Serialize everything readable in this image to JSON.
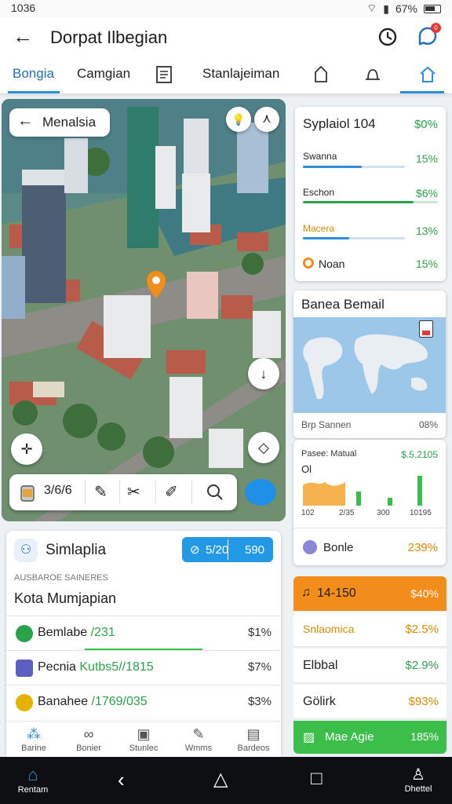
{
  "status": {
    "time": "1036",
    "battery": "67%"
  },
  "appbar": {
    "title": "Dorpat Ilbegian"
  },
  "tabs": [
    {
      "label": "Bongia",
      "active": true
    },
    {
      "label": "Camgian",
      "active": false
    },
    {
      "label": "Stanlajeiman",
      "active": false
    }
  ],
  "map": {
    "search_label": "Menalsia",
    "toolbar_label": "3/6/6"
  },
  "card_stats": {
    "title": "Syplaiol 104",
    "title_pct": "$0%",
    "rows": [
      {
        "label": "Swanna",
        "pct": "15%",
        "fill": 0.58,
        "color": "#2d8fdc"
      },
      {
        "label": "Eschon",
        "pct": "$6%",
        "fill": 0.82,
        "color": "#2aa34a"
      },
      {
        "label": "Macera",
        "pct": "13%",
        "fill": 0.45,
        "color": "#2d8fdc"
      },
      {
        "label": "Noan",
        "pct": "15%",
        "fill": 0,
        "color": "#f28c1a"
      }
    ]
  },
  "card_map": {
    "title": "Banea Bemail",
    "footer_label": "Brp Sannen",
    "footer_pct": "08%"
  },
  "card_chart": {
    "left_label": "Pasee: Matual",
    "left_sub": "Ol",
    "right_value": "$.5.2105",
    "x_ticks": [
      "102",
      "2/35",
      "300",
      "10195"
    ],
    "bars": [
      0.55,
      0.35,
      0.2,
      0.75
    ],
    "bottom_label": "Bonle",
    "bottom_pct": "239%"
  },
  "bottom_panel": {
    "title": "Simlaplia",
    "pill_a": "5/20",
    "pill_b": "590",
    "caption": "AUSBAROE SAINERES",
    "heading": "Kota Mumjapian",
    "rows": [
      {
        "name": "Bemlabe",
        "code": "/231",
        "val": "$1%",
        "icon_color": "#2aa34a"
      },
      {
        "name": "Pecnia",
        "code": "Kutbs5//1815",
        "val": "$7%",
        "icon_color": "#5c5fc0"
      },
      {
        "name": "Banahee",
        "code": "/1769/035",
        "val": "$3%",
        "icon_color": "#e6b200"
      }
    ]
  },
  "mini_nav": [
    {
      "label": "Barine",
      "icon": "dots-icon"
    },
    {
      "label": "Bonier",
      "icon": "link-icon"
    },
    {
      "label": "Stunlec",
      "icon": "card-icon"
    },
    {
      "label": "Wmms",
      "icon": "edit-icon"
    },
    {
      "label": "Bardeos",
      "icon": "wallet-icon"
    }
  ],
  "right_list": {
    "header": "14-150",
    "header_pct": "$40%",
    "rows": [
      {
        "name": "Snlaomica",
        "val": "$2.5%",
        "name_color": "#e08a00",
        "val_color": "#e08a00"
      },
      {
        "name": "Elbbal",
        "val": "$2.9%",
        "name_color": "#222",
        "val_color": "#2aa34a"
      },
      {
        "name": "Gölirk",
        "val": "$93%",
        "name_color": "#222",
        "val_color": "#e08a00"
      }
    ],
    "footer": "Mae Agie",
    "footer_pct": "185%"
  },
  "system_nav": {
    "home_label": "Rentam",
    "profile_label": "Dhettel"
  },
  "colors": {
    "accent": "#2d8fdc",
    "green": "#2aa34a",
    "orange": "#f28c1a",
    "green_bar": "#3cbf4a"
  }
}
